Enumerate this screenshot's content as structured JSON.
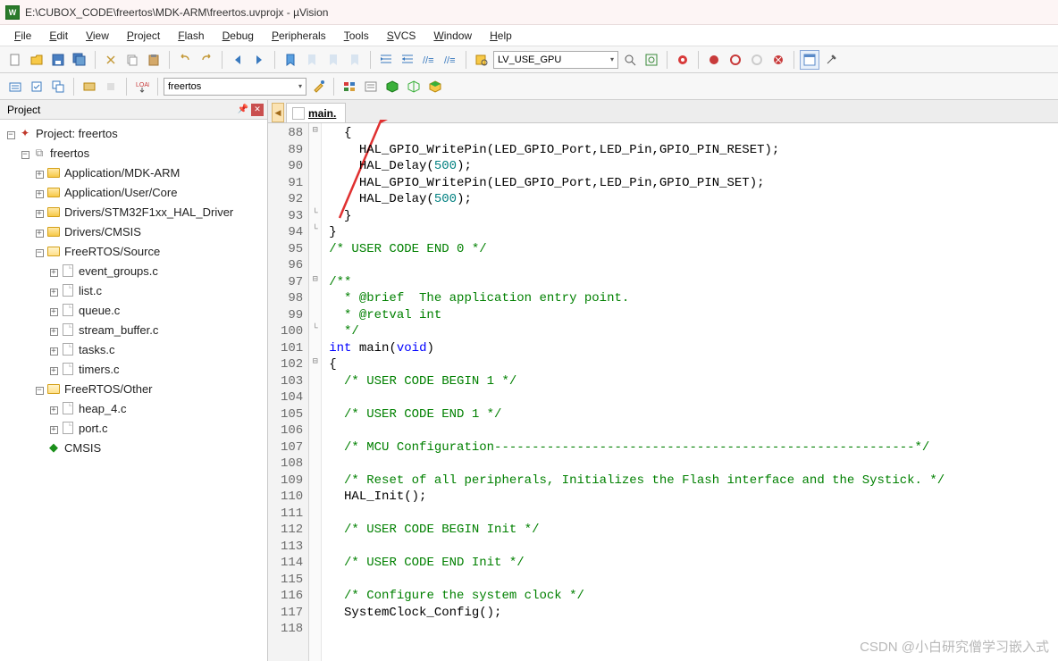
{
  "title": "E:\\CUBOX_CODE\\freertos\\MDK-ARM\\freertos.uvprojx - µVision",
  "app_icon_text": "W",
  "menu": [
    "File",
    "Edit",
    "View",
    "Project",
    "Flash",
    "Debug",
    "Peripherals",
    "Tools",
    "SVCS",
    "Window",
    "Help"
  ],
  "toolbar_combo1": "LV_USE_GPU",
  "toolbar2_combo": "freertos",
  "panel": {
    "title": "Project"
  },
  "tree": [
    {
      "lvl": 0,
      "exp": "-",
      "icon": "proj",
      "label": "Project: freertos"
    },
    {
      "lvl": 1,
      "exp": "-",
      "icon": "target",
      "label": "freertos"
    },
    {
      "lvl": 2,
      "exp": "+",
      "icon": "folder",
      "label": "Application/MDK-ARM"
    },
    {
      "lvl": 2,
      "exp": "+",
      "icon": "folder",
      "label": "Application/User/Core"
    },
    {
      "lvl": 2,
      "exp": "+",
      "icon": "folder",
      "label": "Drivers/STM32F1xx_HAL_Driver"
    },
    {
      "lvl": 2,
      "exp": "+",
      "icon": "folder",
      "label": "Drivers/CMSIS"
    },
    {
      "lvl": 2,
      "exp": "-",
      "icon": "folder-open",
      "label": "FreeRTOS/Source"
    },
    {
      "lvl": 3,
      "exp": "+",
      "icon": "file",
      "label": "event_groups.c"
    },
    {
      "lvl": 3,
      "exp": "+",
      "icon": "file",
      "label": "list.c"
    },
    {
      "lvl": 3,
      "exp": "+",
      "icon": "file",
      "label": "queue.c"
    },
    {
      "lvl": 3,
      "exp": "+",
      "icon": "file",
      "label": "stream_buffer.c"
    },
    {
      "lvl": 3,
      "exp": "+",
      "icon": "file",
      "label": "tasks.c"
    },
    {
      "lvl": 3,
      "exp": "+",
      "icon": "file",
      "label": "timers.c"
    },
    {
      "lvl": 2,
      "exp": "-",
      "icon": "folder-open",
      "label": "FreeRTOS/Other"
    },
    {
      "lvl": 3,
      "exp": "+",
      "icon": "file",
      "label": "heap_4.c"
    },
    {
      "lvl": 3,
      "exp": "+",
      "icon": "file",
      "label": "port.c"
    },
    {
      "lvl": 2,
      "exp": "",
      "icon": "diamond",
      "label": "CMSIS"
    }
  ],
  "tab": {
    "name": "main."
  },
  "code_start_line": 88,
  "code_lines": [
    {
      "n": 88,
      "fold": "⊟",
      "html": "  {"
    },
    {
      "n": 89,
      "fold": "",
      "html": "    HAL_GPIO_WritePin(LED_GPIO_Port,LED_Pin,GPIO_PIN_RESET);"
    },
    {
      "n": 90,
      "fold": "",
      "html": "    HAL_Delay(<span class='c-number'>500</span>);"
    },
    {
      "n": 91,
      "fold": "",
      "html": "    HAL_GPIO_WritePin(LED_GPIO_Port,LED_Pin,GPIO_PIN_SET);"
    },
    {
      "n": 92,
      "fold": "",
      "html": "    HAL_Delay(<span class='c-number'>500</span>);"
    },
    {
      "n": 93,
      "fold": "└",
      "html": "  }"
    },
    {
      "n": 94,
      "fold": "└",
      "html": "}"
    },
    {
      "n": 95,
      "fold": "",
      "html": "<span class='c-comment'>/* USER CODE END 0 */</span>"
    },
    {
      "n": 96,
      "fold": "",
      "html": ""
    },
    {
      "n": 97,
      "fold": "⊟",
      "html": "<span class='c-comment'>/**</span>"
    },
    {
      "n": 98,
      "fold": "",
      "html": "<span class='c-comment'>  * @brief  The application entry point.</span>"
    },
    {
      "n": 99,
      "fold": "",
      "html": "<span class='c-comment'>  * @retval int</span>"
    },
    {
      "n": 100,
      "fold": "└",
      "html": "<span class='c-comment'>  */</span>"
    },
    {
      "n": 101,
      "fold": "",
      "html": "<span class='c-keyword'>int</span> main(<span class='c-keyword'>void</span>)"
    },
    {
      "n": 102,
      "fold": "⊟",
      "html": "{"
    },
    {
      "n": 103,
      "fold": "",
      "html": "  <span class='c-comment'>/* USER CODE BEGIN 1 */</span>"
    },
    {
      "n": 104,
      "fold": "",
      "html": ""
    },
    {
      "n": 105,
      "fold": "",
      "html": "  <span class='c-comment'>/* USER CODE END 1 */</span>"
    },
    {
      "n": 106,
      "fold": "",
      "html": ""
    },
    {
      "n": 107,
      "fold": "",
      "html": "  <span class='c-comment'>/* MCU Configuration--------------------------------------------------------*/</span>"
    },
    {
      "n": 108,
      "fold": "",
      "html": ""
    },
    {
      "n": 109,
      "fold": "",
      "html": "  <span class='c-comment'>/* Reset of all peripherals, Initializes the Flash interface and the Systick. */</span>"
    },
    {
      "n": 110,
      "fold": "",
      "html": "  HAL_Init();"
    },
    {
      "n": 111,
      "fold": "",
      "html": ""
    },
    {
      "n": 112,
      "fold": "",
      "html": "  <span class='c-comment'>/* USER CODE BEGIN Init */</span>"
    },
    {
      "n": 113,
      "fold": "",
      "html": ""
    },
    {
      "n": 114,
      "fold": "",
      "html": "  <span class='c-comment'>/* USER CODE END Init */</span>"
    },
    {
      "n": 115,
      "fold": "",
      "html": ""
    },
    {
      "n": 116,
      "fold": "",
      "html": "  <span class='c-comment'>/* Configure the system clock */</span>"
    },
    {
      "n": 117,
      "fold": "",
      "html": "  SystemClock_Config();"
    },
    {
      "n": 118,
      "fold": "",
      "html": ""
    }
  ],
  "watermark": "CSDN @小白研究僧学习嵌入式"
}
